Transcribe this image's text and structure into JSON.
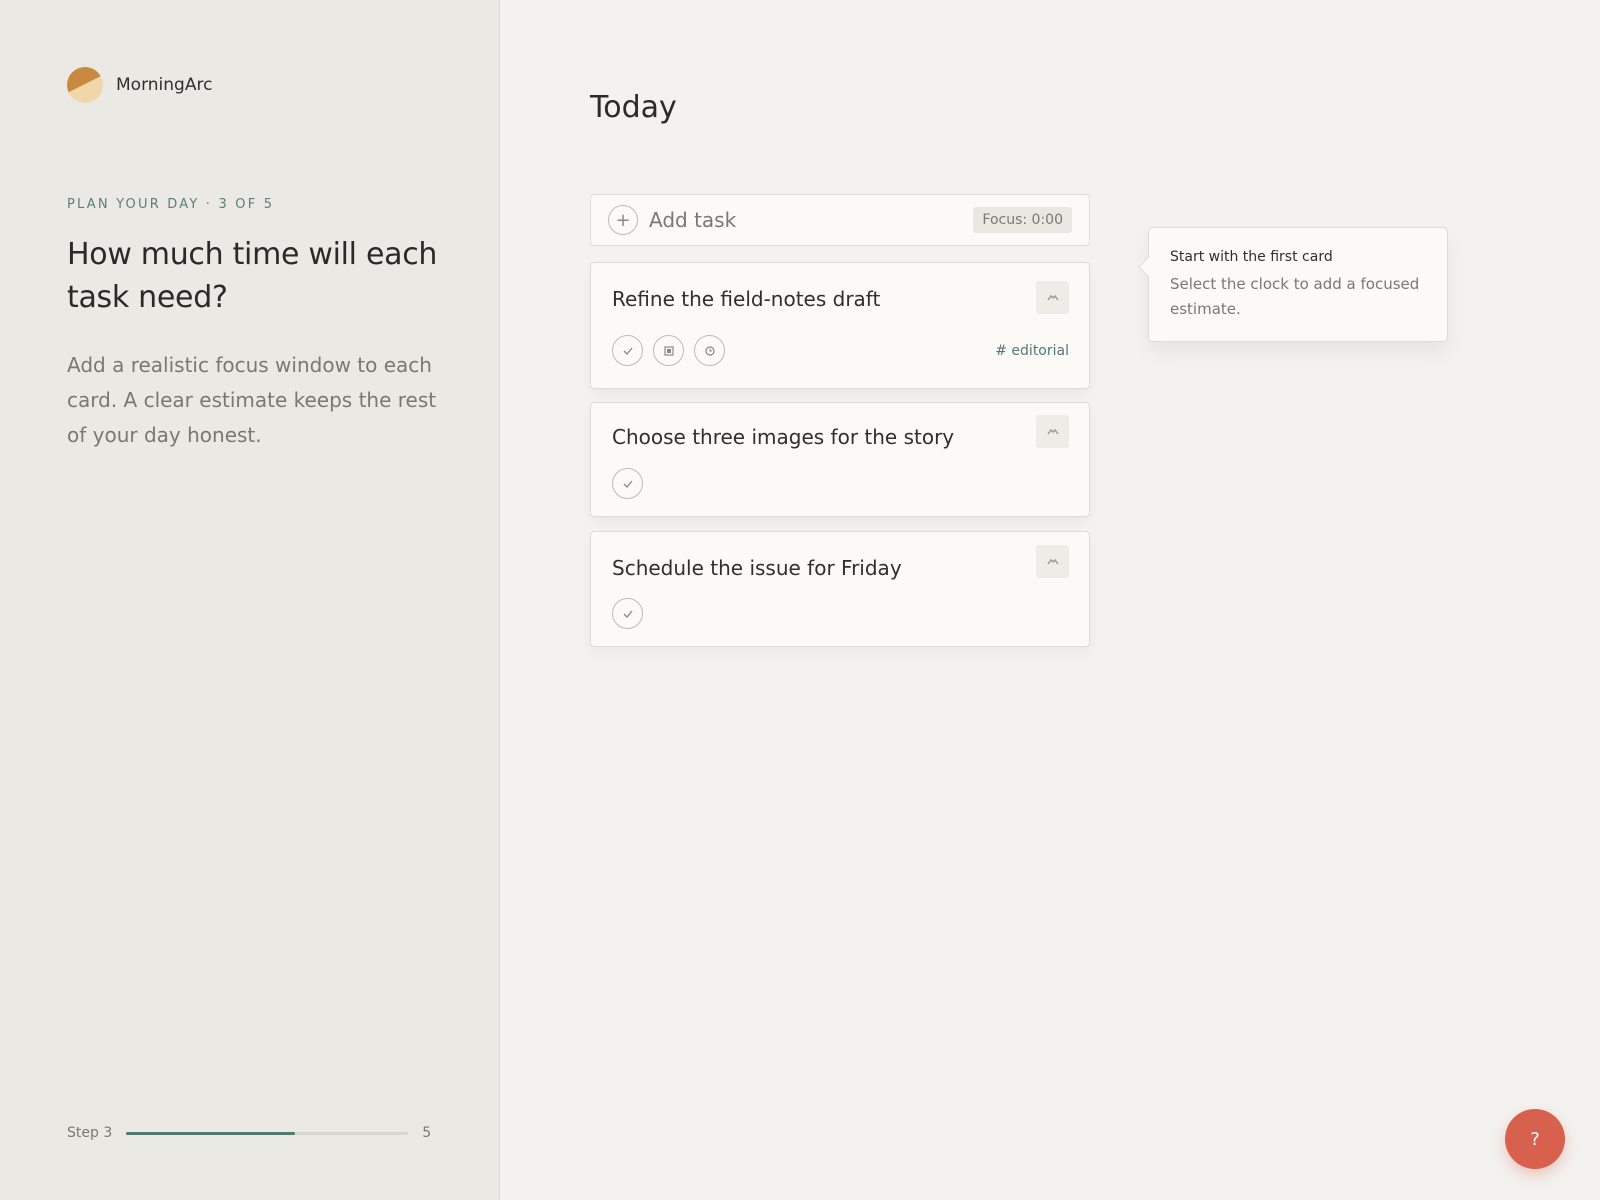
{
  "brand": {
    "name": "MorningArc",
    "logo_icon": "sun-arc-icon",
    "colors": {
      "dark": "#c9893f",
      "light": "#f0d6a8"
    }
  },
  "onboarding": {
    "eyebrow": "PLAN YOUR DAY · 3 OF 5",
    "question": "How much time will each task need?",
    "lead": "Add a realistic focus window to each card. A clear estimate keeps the rest of your day honest.",
    "progress": {
      "label": "Step 3",
      "total": "5",
      "fraction": 0.6
    }
  },
  "main": {
    "title": "Today",
    "add_task": {
      "label": "Add task",
      "icon": "plus-icon",
      "focus_badge": "Focus: 0:00"
    },
    "tasks": [
      {
        "title": "Refine the field-notes draft",
        "tag": "# editorial",
        "actions": [
          "check-icon",
          "note-icon",
          "clock-icon"
        ],
        "drag_icon": "drag-handle-icon"
      },
      {
        "title": "Choose three images for the story",
        "actions": [
          "check-icon"
        ],
        "drag_icon": "drag-handle-icon"
      },
      {
        "title": "Schedule the issue for Friday",
        "actions": [
          "check-icon"
        ],
        "drag_icon": "drag-handle-icon"
      }
    ]
  },
  "tooltip": {
    "title": "Start with the first card",
    "body": "Select the clock to add a focused estimate."
  },
  "help": {
    "label": "?"
  },
  "colors": {
    "accent": "#527a70",
    "help": "#d8604e"
  }
}
